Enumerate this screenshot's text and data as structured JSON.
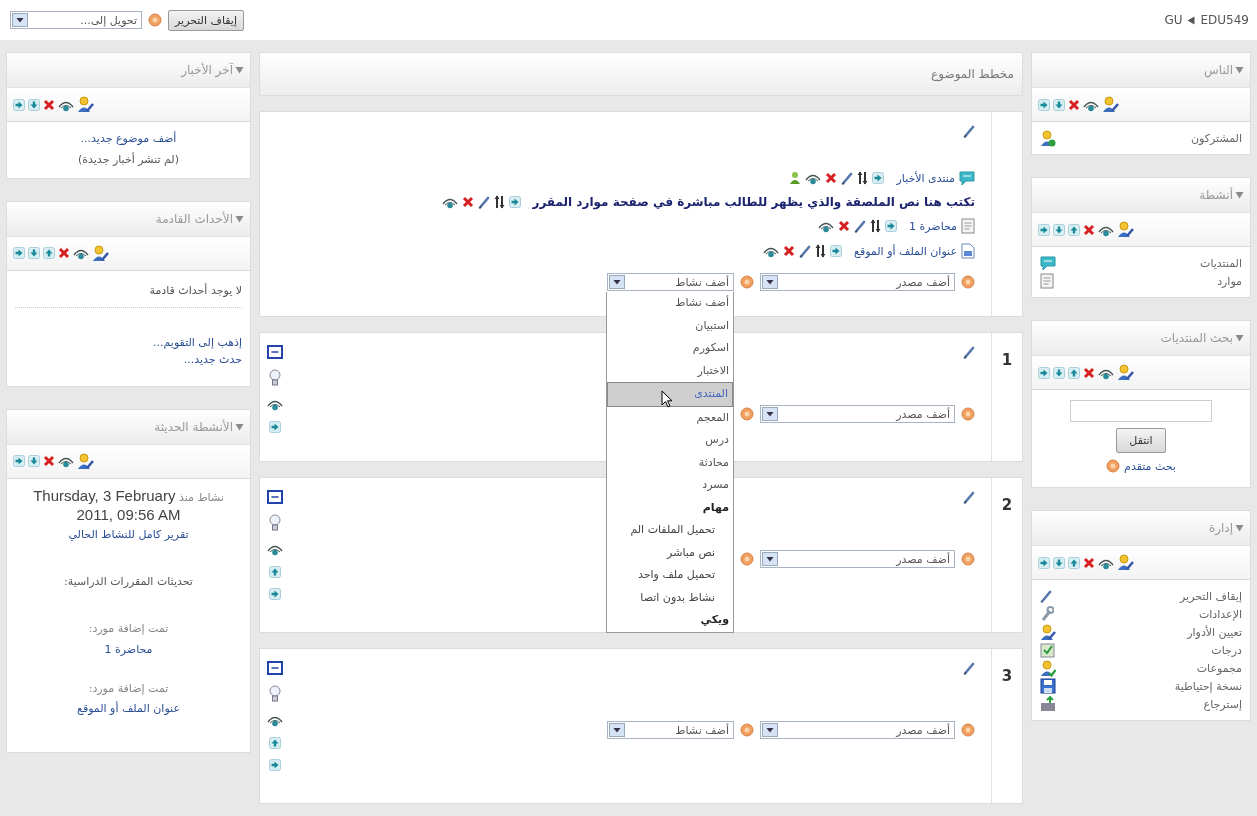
{
  "topbar": {
    "breadcrumb": [
      "EDU549",
      "GU"
    ],
    "edit_button": "إيقاف التحرير",
    "jump_select": "تحويل إلى..."
  },
  "left_blocks": [
    {
      "kind": "news",
      "title": "آخر الأخبار",
      "arrows": [
        {
          "kind": "right"
        },
        {
          "kind": "down"
        }
      ],
      "add_link": "أضف موضوع جديد...",
      "note": "(لم تنشر أخبار جديدة)"
    },
    {
      "kind": "events",
      "title": "الأحداث القادمة",
      "arrows": [
        {
          "kind": "right"
        },
        {
          "kind": "down"
        },
        {
          "kind": "up"
        }
      ],
      "empty": "لا يوجد أحداث قادمة",
      "links": [
        "إذهب إلى التقويم...",
        "حدث جديد..."
      ]
    },
    {
      "kind": "recent",
      "title": "الأنشطة الحديثة",
      "arrows": [
        {
          "kind": "right"
        },
        {
          "kind": "down"
        }
      ],
      "since_label": "نشاط منذ",
      "date": "Thursday, 3 February 2011, 09:56 AM",
      "report_link": "تقرير كامل للنشاط الحالي",
      "updates_heading": "تحديثات المقررات الدراسية:",
      "updates": [
        {
          "label": "تمت إضافة مورد:",
          "link": "محاضرة 1"
        },
        {
          "label": "تمت إضافة مورد:",
          "link": "عنوان الملف أو الموقع"
        }
      ]
    }
  ],
  "course": {
    "title": "مخطط الموضوع",
    "sections": [
      {
        "items": [
          {
            "kind": "forum",
            "text": "منتدى الأخبار"
          },
          {
            "kind": "label",
            "text": "تكتب هنا نص الملصقة والذي يظهر للطالب مباشرة في صفحة موارد المقرر"
          },
          {
            "kind": "page",
            "text": "محاضرة 1"
          },
          {
            "kind": "file",
            "text": "عنوان الملف أو الموقع"
          }
        ],
        "selects": [
          {
            "kind": "select",
            "label": "أضف مصدر"
          },
          {
            "kind": "select",
            "label": "أضف نشاط",
            "options": [
              {
                "kind": "option",
                "label": "أضف نشاط",
                "selected": false
              },
              {
                "kind": "option",
                "label": "استبيان",
                "selected": false
              },
              {
                "kind": "option",
                "label": "اسكورم",
                "selected": false
              },
              {
                "kind": "option",
                "label": "الاختبار",
                "selected": false
              },
              {
                "kind": "option",
                "label": "المنتدى",
                "selected": true
              },
              {
                "kind": "option",
                "label": "المعجم",
                "selected": false
              },
              {
                "kind": "option",
                "label": "درس",
                "selected": false
              },
              {
                "kind": "option",
                "label": "محادثة",
                "selected": false
              },
              {
                "kind": "option",
                "label": "مسرد",
                "selected": false
              },
              {
                "kind": "group",
                "label": "مهام",
                "selected": false
              },
              {
                "kind": "sub",
                "label": "تحميل الملفات الم",
                "selected": false
              },
              {
                "kind": "sub",
                "label": "نص مباشر",
                "selected": false
              },
              {
                "kind": "sub",
                "label": "تحميل ملف واحد",
                "selected": false
              },
              {
                "kind": "sub",
                "label": "نشاط بدون اتصا",
                "selected": false
              },
              {
                "kind": "group",
                "label": "ويكي",
                "selected": false
              }
            ]
          }
        ]
      },
      {
        "number": "1",
        "arrows": [
          {
            "kind": "right"
          }
        ],
        "selects": [
          {
            "kind": "select",
            "label": "أضف مصدر"
          },
          {
            "kind": "covered"
          }
        ]
      },
      {
        "number": "2",
        "arrows": [
          {
            "kind": "up"
          },
          {
            "kind": "right"
          }
        ],
        "selects": [
          {
            "kind": "select",
            "label": "أضف مصدر"
          },
          {
            "kind": "covered"
          }
        ]
      },
      {
        "number": "3",
        "arrows": [
          {
            "kind": "up"
          },
          {
            "kind": "right"
          }
        ],
        "selects": [
          {
            "kind": "select",
            "label": "أضف مصدر"
          },
          {
            "kind": "select",
            "label": "أضف نشاط"
          }
        ]
      }
    ]
  },
  "right_blocks": [
    {
      "kind": "list",
      "title": "الناس",
      "arrows": [
        {
          "kind": "right"
        },
        {
          "kind": "down"
        }
      ],
      "items": [
        {
          "kind": "users",
          "label": "المشتركون"
        }
      ]
    },
    {
      "kind": "list",
      "title": "أنشطة",
      "arrows": [
        {
          "kind": "right"
        },
        {
          "kind": "down"
        },
        {
          "kind": "up"
        }
      ],
      "items": [
        {
          "kind": "forum",
          "label": "المنتديات"
        },
        {
          "kind": "page",
          "label": "موارد"
        }
      ]
    },
    {
      "kind": "search",
      "title": "بحث المنتديات",
      "arrows": [
        {
          "kind": "right"
        },
        {
          "kind": "down"
        },
        {
          "kind": "up"
        }
      ],
      "button": "انتقل",
      "advanced": "بحث متقدم"
    },
    {
      "kind": "list",
      "title": "إدارة",
      "arrows": [
        {
          "kind": "right"
        },
        {
          "kind": "down"
        },
        {
          "kind": "up"
        }
      ],
      "items": [
        {
          "kind": "edit",
          "label": "إيقاف التحرير"
        },
        {
          "kind": "settings",
          "label": "الإعدادات"
        },
        {
          "kind": "roles",
          "label": "تعيين الأدوار"
        },
        {
          "kind": "grades",
          "label": "درجات"
        },
        {
          "kind": "groups",
          "label": "مجموعات"
        },
        {
          "kind": "backup",
          "label": "نسخة إحتياطية"
        },
        {
          "kind": "restore",
          "label": "إسترجاع"
        }
      ]
    }
  ]
}
